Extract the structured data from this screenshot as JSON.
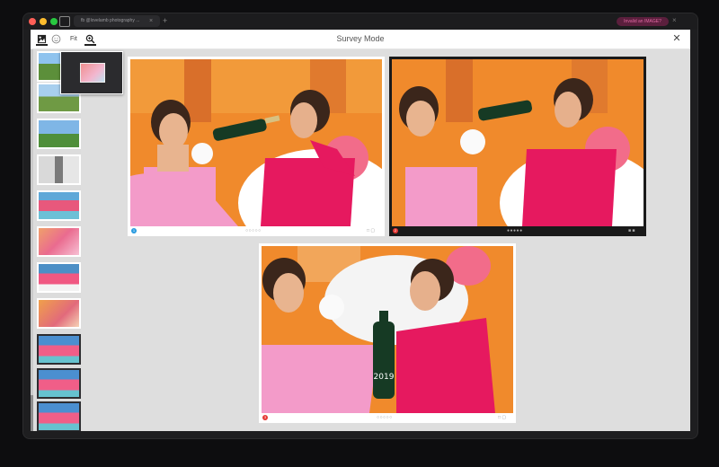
{
  "browser": {
    "tab_title": "fb @lovelamb photography ...",
    "tab_close": "×",
    "new_tab": "+",
    "top_pill": "Invalid an IMAGE?",
    "top_pill_close": "×"
  },
  "header": {
    "fit_label": "Fit",
    "title": "Survey Mode",
    "close": "✕"
  },
  "cards": [
    {
      "index_badge": "1",
      "badge_color": "#2a9be0",
      "dots": "○○○○○",
      "buttons": "□ ▢"
    },
    {
      "index_badge": "2",
      "badge_color": "#e53935",
      "dots": "●●●●●",
      "buttons": "■ ■"
    },
    {
      "index_badge": "3",
      "badge_color": "#e53935",
      "dots": "○○○○○",
      "buttons": "□ ▢"
    }
  ],
  "bottle_label": "2019",
  "colors": {
    "accent_blue": "#2a9be0",
    "accent_red": "#e53935",
    "dress_pink": "#e6195f",
    "dress_light_pink": "#f07ab6",
    "orange_bg": "#f08a2c"
  },
  "icons": {
    "image": "image-icon",
    "emoji": "smiley-icon",
    "zoom": "zoom-in-icon",
    "close": "close-icon"
  }
}
